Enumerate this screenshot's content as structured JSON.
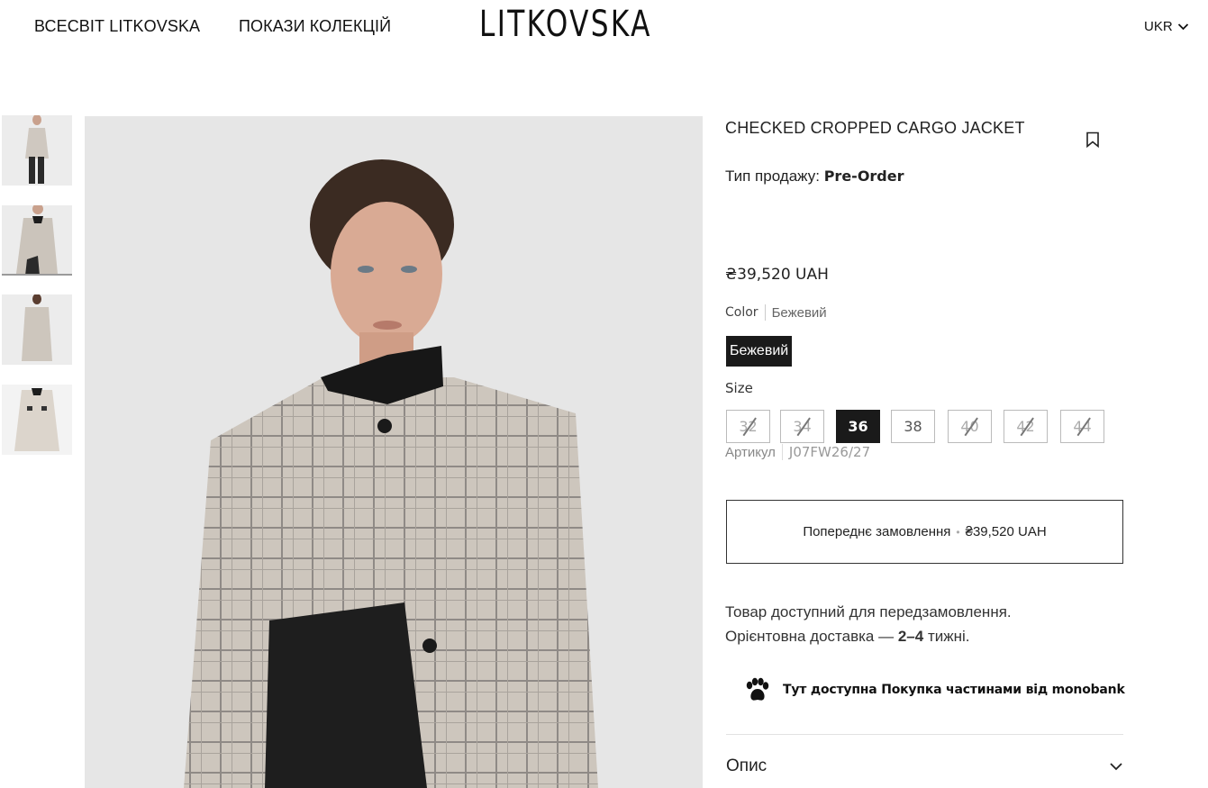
{
  "header": {
    "nav": [
      "ВСЕСВІТ LITKOVSKA",
      "ПОКАЗИ КОЛЕКЦІЙ"
    ],
    "logo": "LITKOVSKA",
    "language": "UKR",
    "language_icon": "chevron-down-icon"
  },
  "gallery": {
    "thumbnail_count": 4,
    "active_thumbnail": 2
  },
  "product": {
    "title": "CHECKED CROPPED CARGO JACKET",
    "sale_type_label": "Тип продажу:",
    "sale_type_value": "Pre-Order",
    "price": "₴39,520 UAH",
    "color_label": "Color",
    "color_value": "Бежевий",
    "color_option": "Бежевий",
    "size_label": "Size",
    "sizes": [
      {
        "label": "32",
        "available": false
      },
      {
        "label": "34",
        "available": false
      },
      {
        "label": "36",
        "available": true,
        "selected": true
      },
      {
        "label": "38",
        "available": true
      },
      {
        "label": "40",
        "available": false
      },
      {
        "label": "42",
        "available": false
      },
      {
        "label": "44",
        "available": false
      }
    ],
    "sku_label": "Артикул",
    "sku_value": "J07FW26/27",
    "preorder_button": "Попереднє замовлення",
    "preorder_price": "₴39,520 UAH",
    "availability_line1": "Товар доступний для передзамовлення.",
    "availability_line2_prefix": "Орієнтовна доставка —",
    "availability_line2_bold": "2–4",
    "availability_line2_suffix": "тижні.",
    "monobank_text": "Тут доступна Покупка частинами від monobank",
    "description_label": "Опис"
  },
  "colors": {
    "text": "#1a1a1a",
    "selected_bg": "#1a1a1a",
    "border": "#bbbbbb"
  }
}
